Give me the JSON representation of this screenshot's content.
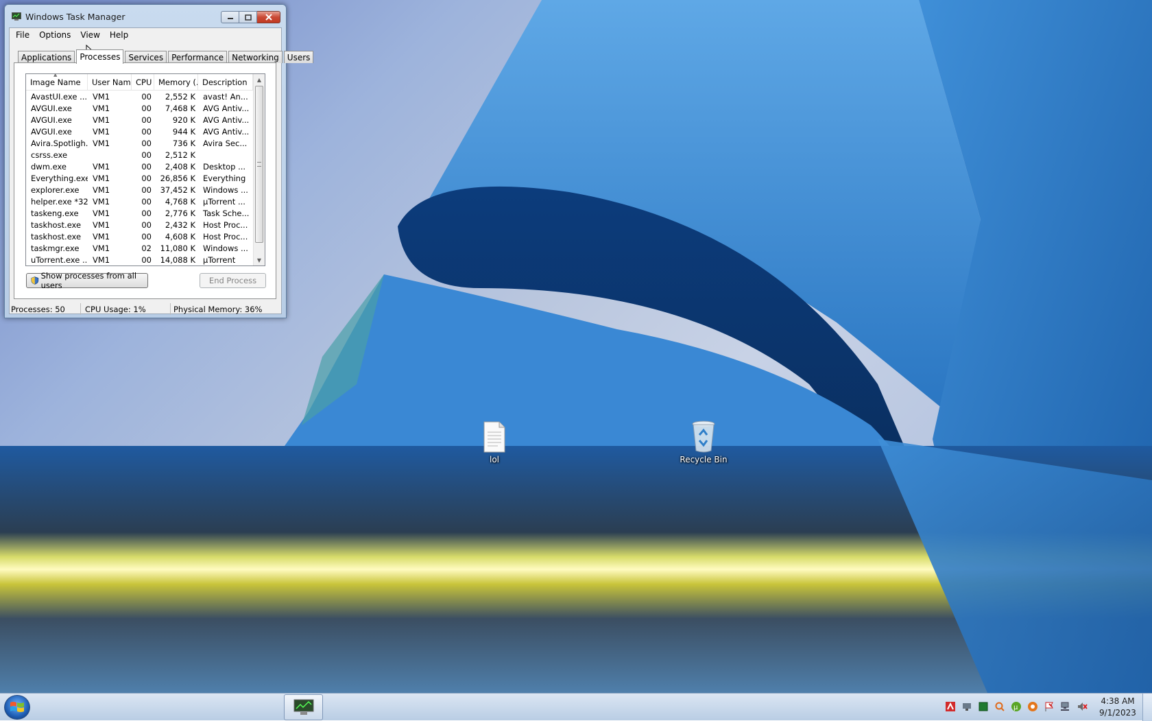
{
  "window": {
    "title": "Windows Task Manager",
    "menu": [
      "File",
      "Options",
      "View",
      "Help"
    ],
    "tabs": [
      "Applications",
      "Processes",
      "Services",
      "Performance",
      "Networking",
      "Users"
    ],
    "active_tab": "Processes",
    "columns": [
      "Image Name",
      "User Name",
      "CPU",
      "Memory (...",
      "Description"
    ],
    "rows": [
      [
        "AvastUI.exe ...",
        "VM1",
        "00",
        "2,552 K",
        "avast! An..."
      ],
      [
        "AVGUI.exe",
        "VM1",
        "00",
        "7,468 K",
        "AVG Antiv..."
      ],
      [
        "AVGUI.exe",
        "VM1",
        "00",
        "920 K",
        "AVG Antiv..."
      ],
      [
        "AVGUI.exe",
        "VM1",
        "00",
        "944 K",
        "AVG Antiv..."
      ],
      [
        "Avira.Spotligh...",
        "VM1",
        "00",
        "736 K",
        "Avira Sec..."
      ],
      [
        "csrss.exe",
        "",
        "00",
        "2,512 K",
        ""
      ],
      [
        "dwm.exe",
        "VM1",
        "00",
        "2,408 K",
        "Desktop ..."
      ],
      [
        "Everything.exe",
        "VM1",
        "00",
        "26,856 K",
        "Everything"
      ],
      [
        "explorer.exe",
        "VM1",
        "00",
        "37,452 K",
        "Windows ..."
      ],
      [
        "helper.exe *32",
        "VM1",
        "00",
        "4,768 K",
        "µTorrent ..."
      ],
      [
        "taskeng.exe",
        "VM1",
        "00",
        "2,776 K",
        "Task Sche..."
      ],
      [
        "taskhost.exe",
        "VM1",
        "00",
        "2,432 K",
        "Host Proc..."
      ],
      [
        "taskhost.exe",
        "VM1",
        "00",
        "4,608 K",
        "Host Proc..."
      ],
      [
        "taskmgr.exe",
        "VM1",
        "02",
        "11,080 K",
        "Windows ..."
      ],
      [
        "uTorrent.exe ...",
        "VM1",
        "00",
        "14,088 K",
        "µTorrent"
      ]
    ],
    "show_all_label": "Show processes from all users",
    "end_process_label": "End Process",
    "status": {
      "processes": "Processes: 50",
      "cpu": "CPU Usage: 1%",
      "memory": "Physical Memory: 36%"
    }
  },
  "desktop_icons": {
    "file_label": "lol",
    "recycle_label": "Recycle Bin"
  },
  "taskbar": {
    "time": "4:38 AM",
    "date": "9/1/2023"
  }
}
